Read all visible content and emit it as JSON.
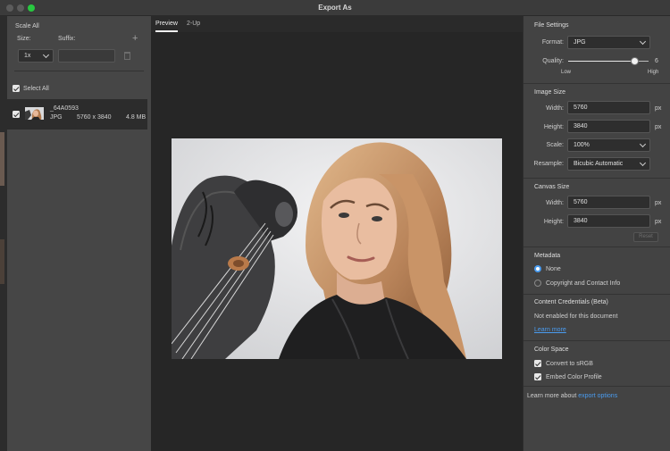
{
  "window": {
    "title": "Export As"
  },
  "left": {
    "scale_all": "Scale All",
    "size_label": "Size:",
    "suffix_label": "Suffix:",
    "scale_value": "1x",
    "add_icon": "+",
    "select_all": "Select All",
    "file": {
      "name": "_64A0593",
      "format": "JPG",
      "dimensions": "5760 x 3840",
      "size": "4.8 MB"
    }
  },
  "tabs": [
    "Preview",
    "2-Up"
  ],
  "file_settings": {
    "heading": "File Settings",
    "format_label": "Format:",
    "format_value": "JPG",
    "quality_label": "Quality:",
    "quality_value": "6",
    "quality_fraction": 0.83,
    "low": "Low",
    "high": "High"
  },
  "image_size": {
    "heading": "Image Size",
    "width_label": "Width:",
    "width": "5760",
    "height_label": "Height:",
    "height": "3840",
    "unit": "px",
    "scale_label": "Scale:",
    "scale": "100%",
    "resample_label": "Resample:",
    "resample": "Bicubic Automatic"
  },
  "canvas_size": {
    "heading": "Canvas Size",
    "width_label": "Width:",
    "width": "5760",
    "height_label": "Height:",
    "height": "3840",
    "unit": "px",
    "reset": "Reset"
  },
  "metadata": {
    "heading": "Metadata",
    "none": "None",
    "copyright": "Copyright and Contact Info"
  },
  "credentials": {
    "heading": "Content Credentials (Beta)",
    "status": "Not enabled for this document",
    "learn_more": "Learn more"
  },
  "color_space": {
    "heading": "Color Space",
    "convert": "Convert to sRGB",
    "embed": "Embed Color Profile"
  },
  "footer": {
    "text": "Learn more about",
    "link": "export options"
  },
  "colors": {
    "accent": "#4a9cf0",
    "panel": "#434343",
    "preview_bg": "#262626"
  }
}
